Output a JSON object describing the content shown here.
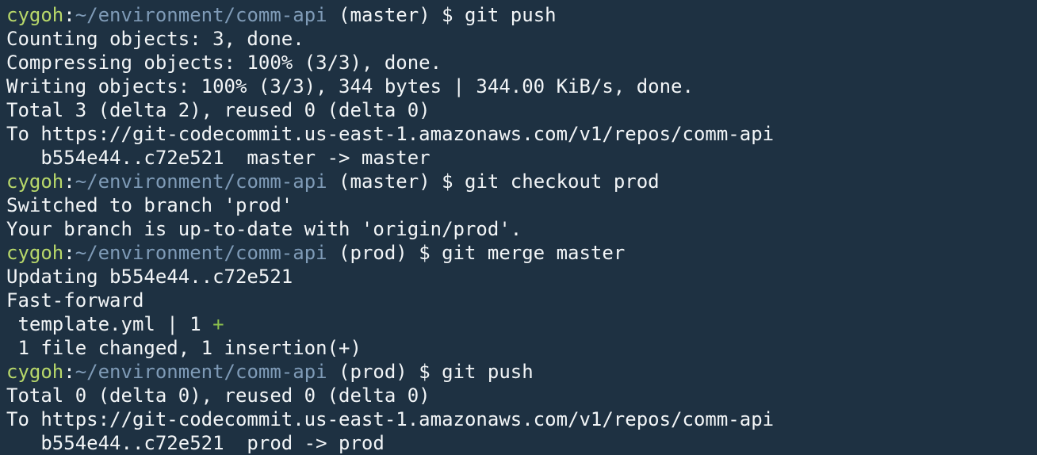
{
  "colors": {
    "background": "#1e3142",
    "user": "#b8d86a",
    "path": "#7f9bb7",
    "text": "#f2f5f7",
    "diff_plus": "#8cc04d"
  },
  "lines": [
    {
      "type": "prompt",
      "user": "cygoh",
      "sep": ":",
      "path": "~/environment/comm-api",
      "branch": " (master) ",
      "cmd": "$ git push"
    },
    {
      "type": "text",
      "text": "Counting objects: 3, done."
    },
    {
      "type": "text",
      "text": "Compressing objects: 100% (3/3), done."
    },
    {
      "type": "text",
      "text": "Writing objects: 100% (3/3), 344 bytes | 344.00 KiB/s, done."
    },
    {
      "type": "text",
      "text": "Total 3 (delta 2), reused 0 (delta 0)"
    },
    {
      "type": "text",
      "text": "To https://git-codecommit.us-east-1.amazonaws.com/v1/repos/comm-api"
    },
    {
      "type": "text",
      "text": "   b554e44..c72e521  master -> master"
    },
    {
      "type": "prompt",
      "user": "cygoh",
      "sep": ":",
      "path": "~/environment/comm-api",
      "branch": " (master) ",
      "cmd": "$ git checkout prod"
    },
    {
      "type": "text",
      "text": "Switched to branch 'prod'"
    },
    {
      "type": "text",
      "text": "Your branch is up-to-date with 'origin/prod'."
    },
    {
      "type": "prompt",
      "user": "cygoh",
      "sep": ":",
      "path": "~/environment/comm-api",
      "branch": " (prod) ",
      "cmd": "$ git merge master"
    },
    {
      "type": "text",
      "text": "Updating b554e44..c72e521"
    },
    {
      "type": "text",
      "text": "Fast-forward"
    },
    {
      "type": "diffstat",
      "text": " template.yml | 1 ",
      "plus": "+"
    },
    {
      "type": "text",
      "text": " 1 file changed, 1 insertion(+)"
    },
    {
      "type": "prompt",
      "user": "cygoh",
      "sep": ":",
      "path": "~/environment/comm-api",
      "branch": " (prod) ",
      "cmd": "$ git push"
    },
    {
      "type": "text",
      "text": "Total 0 (delta 0), reused 0 (delta 0)"
    },
    {
      "type": "text",
      "text": "To https://git-codecommit.us-east-1.amazonaws.com/v1/repos/comm-api"
    },
    {
      "type": "text",
      "text": "   b554e44..c72e521  prod -> prod"
    }
  ]
}
